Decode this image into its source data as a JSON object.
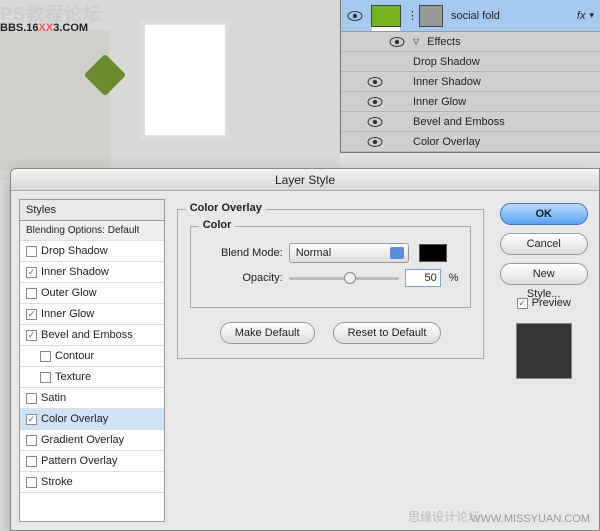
{
  "watermark": {
    "line1": "PS教程论坛",
    "line2a": "BBS.16",
    "xx": "XX",
    "line2b": "3.COM"
  },
  "wm_br": "WWW.MISSYUAN.COM",
  "wm_br2": "思缘设计论坛",
  "layers": {
    "name": "social fold",
    "fx": "fx",
    "effects_header": "Effects",
    "items": [
      "Drop Shadow",
      "Inner Shadow",
      "Inner Glow",
      "Bevel and Emboss",
      "Color Overlay"
    ]
  },
  "dialog": {
    "title": "Layer Style",
    "styles_header": "Styles",
    "blending": "Blending Options: Default",
    "list": [
      {
        "label": "Drop Shadow",
        "checked": false
      },
      {
        "label": "Inner Shadow",
        "checked": true
      },
      {
        "label": "Outer Glow",
        "checked": false
      },
      {
        "label": "Inner Glow",
        "checked": true
      },
      {
        "label": "Bevel and Emboss",
        "checked": true
      },
      {
        "label": "Contour",
        "checked": false,
        "sub": true
      },
      {
        "label": "Texture",
        "checked": false,
        "sub": true
      },
      {
        "label": "Satin",
        "checked": false
      },
      {
        "label": "Color Overlay",
        "checked": true,
        "sel": true
      },
      {
        "label": "Gradient Overlay",
        "checked": false
      },
      {
        "label": "Pattern Overlay",
        "checked": false
      },
      {
        "label": "Stroke",
        "checked": false
      }
    ],
    "section": "Color Overlay",
    "subsection": "Color",
    "blend_mode_label": "Blend Mode:",
    "blend_mode_value": "Normal",
    "opacity_label": "Opacity:",
    "opacity_value": "50",
    "opacity_unit": "%",
    "swatch_color": "#000000",
    "make_default": "Make Default",
    "reset_default": "Reset to Default",
    "ok": "OK",
    "cancel": "Cancel",
    "new_style": "New Style...",
    "preview": "Preview"
  }
}
